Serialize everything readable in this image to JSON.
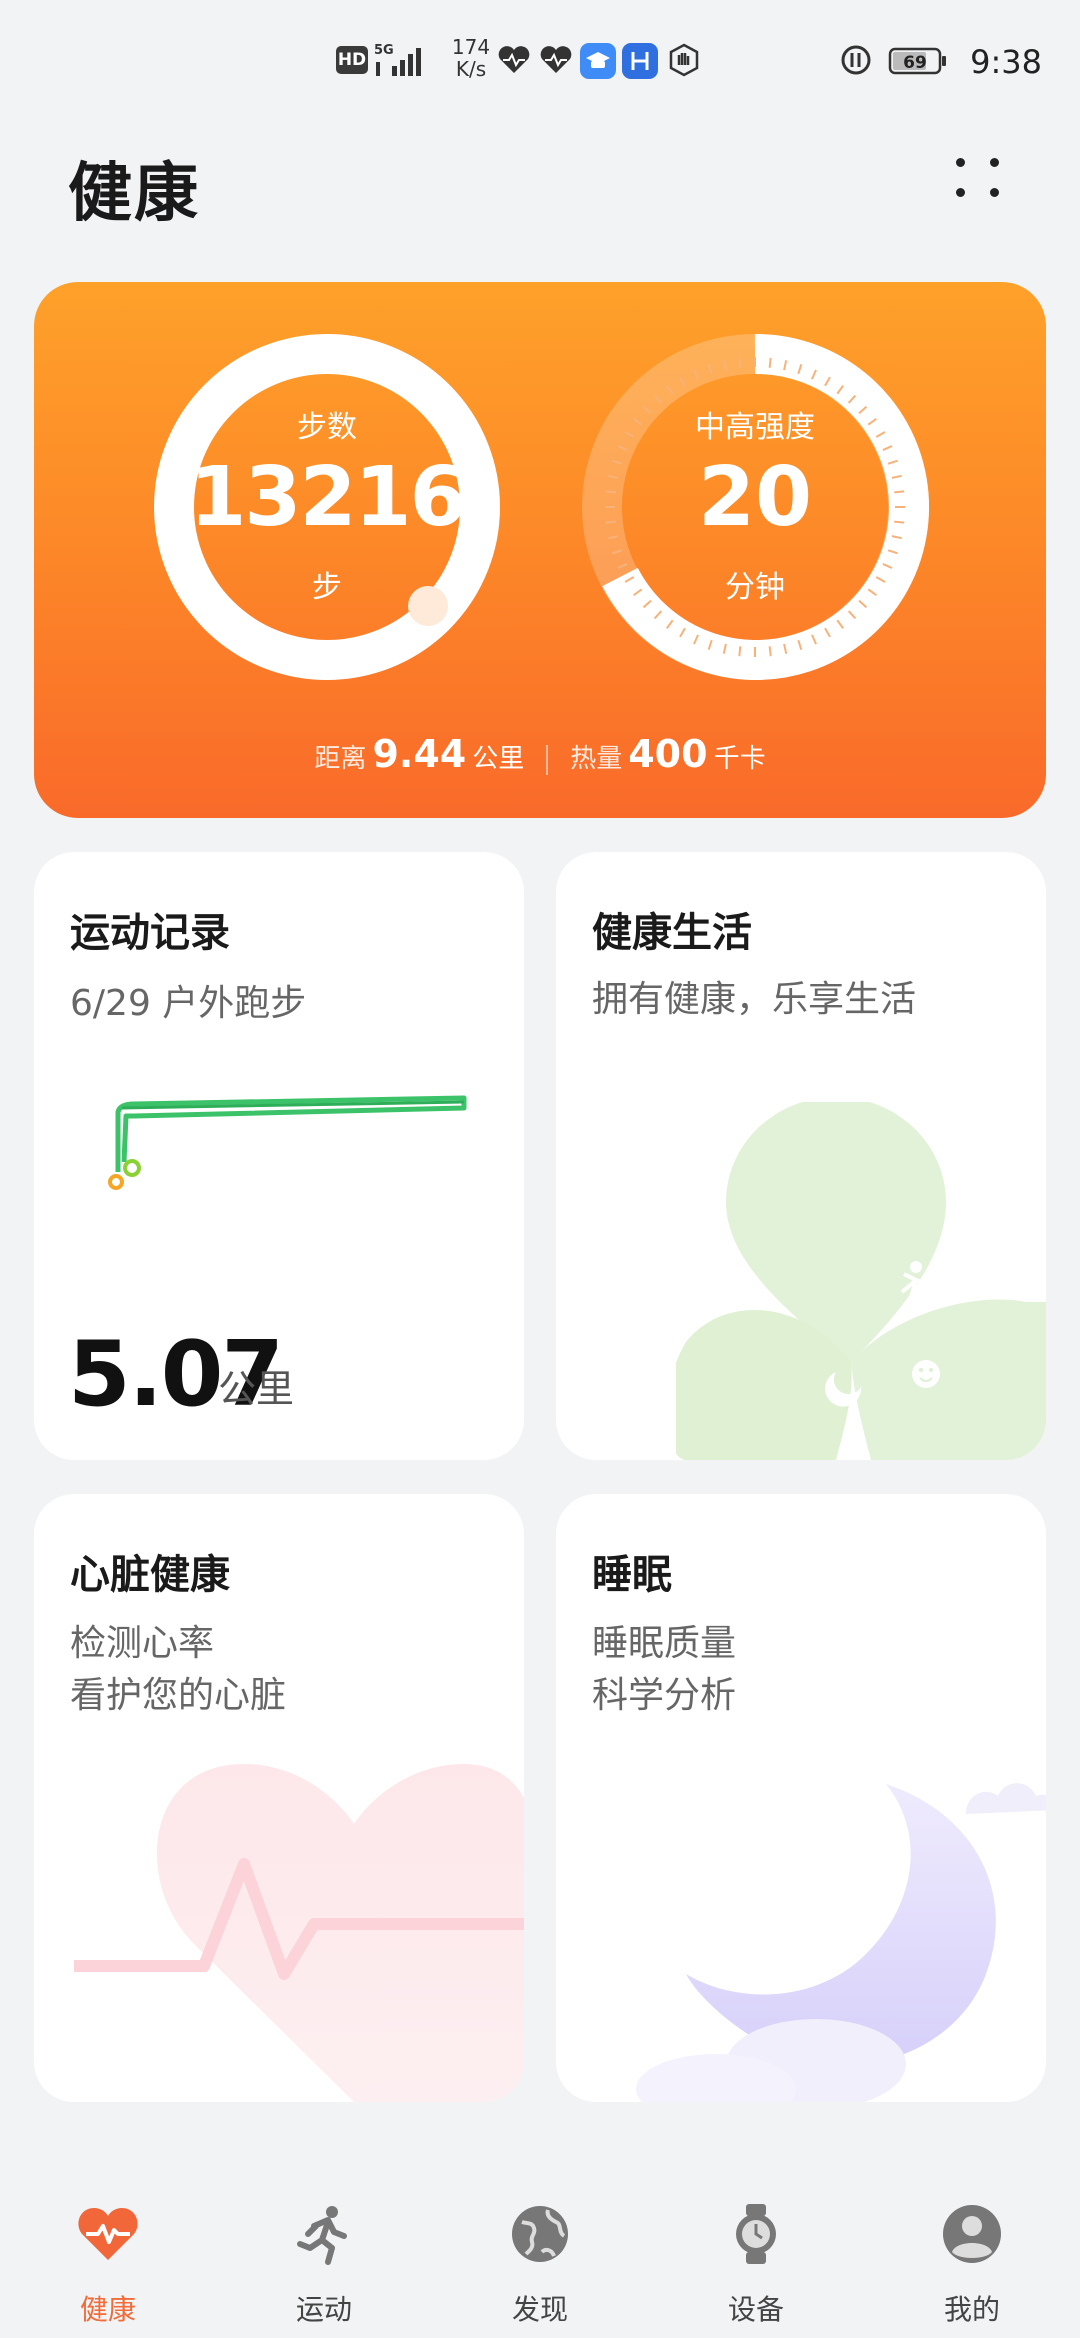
{
  "status_bar": {
    "hd_badge": "HD",
    "network": "5G",
    "speed_value": "174",
    "speed_unit": "K/s",
    "battery": "69",
    "time": "9:38"
  },
  "header": {
    "title": "健康",
    "more_icon": "more-grid-icon"
  },
  "activity": {
    "steps_label": "步数",
    "steps_value": "13216",
    "steps_unit": "步",
    "intensity_label": "中高强度",
    "intensity_value": "20",
    "intensity_unit": "分钟",
    "distance_label": "距离",
    "distance_value": "9.44",
    "distance_unit": "公里",
    "calories_label": "热量",
    "calories_value": "400",
    "calories_unit": "千卡",
    "colors": {
      "card_top": "#fea12a",
      "card_bottom": "#f96a2a",
      "ring": "#ffffff"
    }
  },
  "cards": {
    "exercise": {
      "title": "运动记录",
      "subtitle": "6/29 户外跑步",
      "distance": "5.07",
      "unit": "公里",
      "route_color": "#3cc36a"
    },
    "healthy_life": {
      "title": "健康生活",
      "subtitle": "拥有健康，乐享生活"
    },
    "heart": {
      "title": "心脏健康",
      "line1": "检测心率",
      "line2": "看护您的心脏"
    },
    "sleep": {
      "title": "睡眠",
      "line1": "睡眠质量",
      "line2": "科学分析"
    }
  },
  "bottom_nav": [
    {
      "label": "健康",
      "icon": "heart-pulse-icon",
      "active": true
    },
    {
      "label": "运动",
      "icon": "running-icon",
      "active": false
    },
    {
      "label": "发现",
      "icon": "globe-icon",
      "active": false
    },
    {
      "label": "设备",
      "icon": "watch-icon",
      "active": false
    },
    {
      "label": "我的",
      "icon": "profile-icon",
      "active": false
    }
  ]
}
